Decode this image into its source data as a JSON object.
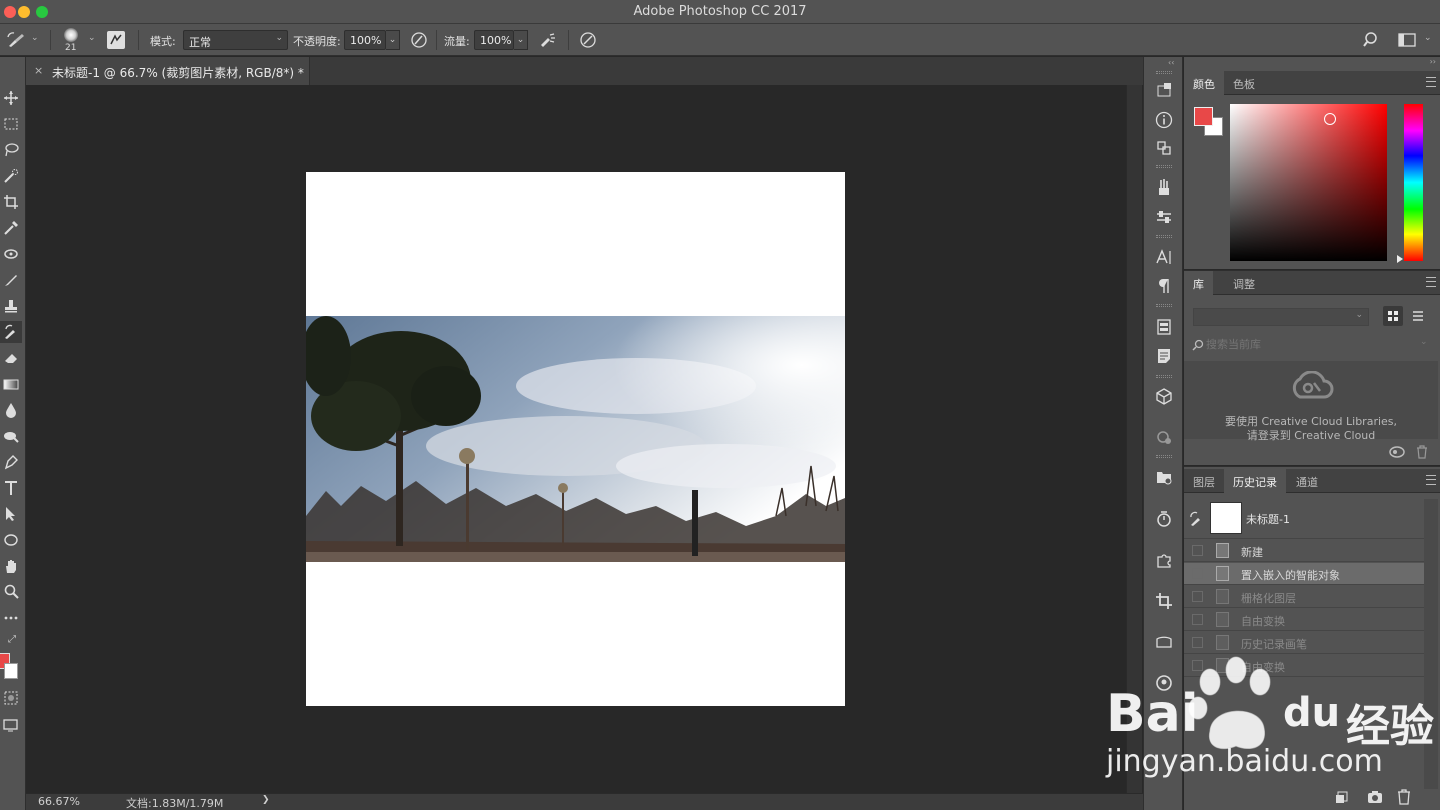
{
  "app": {
    "title": "Adobe Photoshop CC 2017"
  },
  "options_bar": {
    "brush_size": "21",
    "mode_label": "模式:",
    "mode_value": "正常",
    "opacity_label": "不透明度:",
    "opacity_value": "100%",
    "flow_label": "流量:",
    "flow_value": "100%"
  },
  "document": {
    "tab_title": "未标题-1 @ 66.7% (裁剪图片素材, RGB/8*) *",
    "close_glyph": "×"
  },
  "status": {
    "zoom": "66.67%",
    "doc_size": "文档:1.83M/1.79M",
    "arrow": "❯"
  },
  "panels": {
    "color": {
      "tabs": [
        "颜色",
        "色板"
      ],
      "foreground": "#e84848",
      "background": "#ffffff",
      "hue": "#ff0000"
    },
    "library": {
      "tabs": [
        "库",
        "调整"
      ],
      "search_placeholder": "搜索当前库",
      "message_line1": "要使用 Creative Cloud Libraries,",
      "message_line2": "请登录到 Creative Cloud"
    },
    "history": {
      "tabs": [
        "图层",
        "历史记录",
        "通道"
      ],
      "snapshot_name": "未标题-1",
      "items": [
        {
          "label": "新建",
          "state": "normal"
        },
        {
          "label": "置入嵌入的智能对象",
          "state": "selected"
        },
        {
          "label": "栅格化图层",
          "state": "dim"
        },
        {
          "label": "自由变换",
          "state": "dim"
        },
        {
          "label": "历史记录画笔",
          "state": "dim"
        },
        {
          "label": "自由变换",
          "state": "dim"
        }
      ]
    }
  },
  "watermark": {
    "brand_left": "Bai",
    "brand_mid": "du",
    "brand_right": "经验",
    "url": "jingyan.baidu.com"
  },
  "colors": {
    "accent_red": "#e84848",
    "ui_gray": "#535353",
    "canvas_bg": "#282828"
  }
}
